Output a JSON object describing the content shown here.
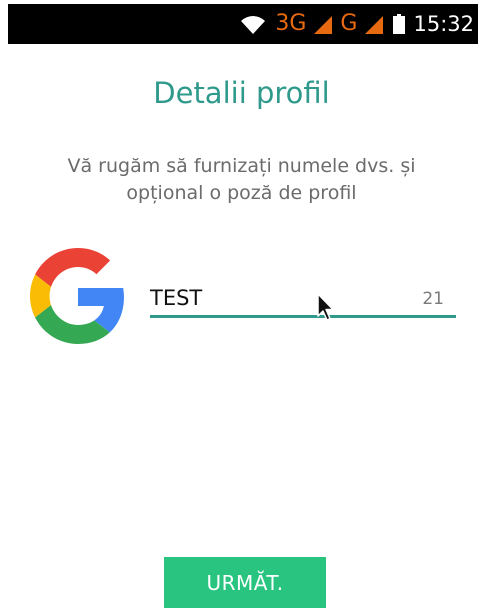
{
  "status_bar": {
    "wifi_icon": "wifi-icon",
    "network_3g": "3G",
    "network_g": "G",
    "signal_icon": "signal-icon",
    "battery_icon": "battery-icon",
    "time": "15:32"
  },
  "screen": {
    "title": "Detalii profil",
    "subtitle_line1": "Vă rugăm să furnizați numele dvs. și",
    "subtitle_line2": "opțional o poză de profil"
  },
  "profile": {
    "avatar_icon": "google-logo",
    "name_value": "TEST",
    "char_counter": "21"
  },
  "actions": {
    "next_label": "URMĂT."
  },
  "colors": {
    "accent": "#2f9a8c",
    "button": "#29c580",
    "status_network": "#e86a10"
  }
}
